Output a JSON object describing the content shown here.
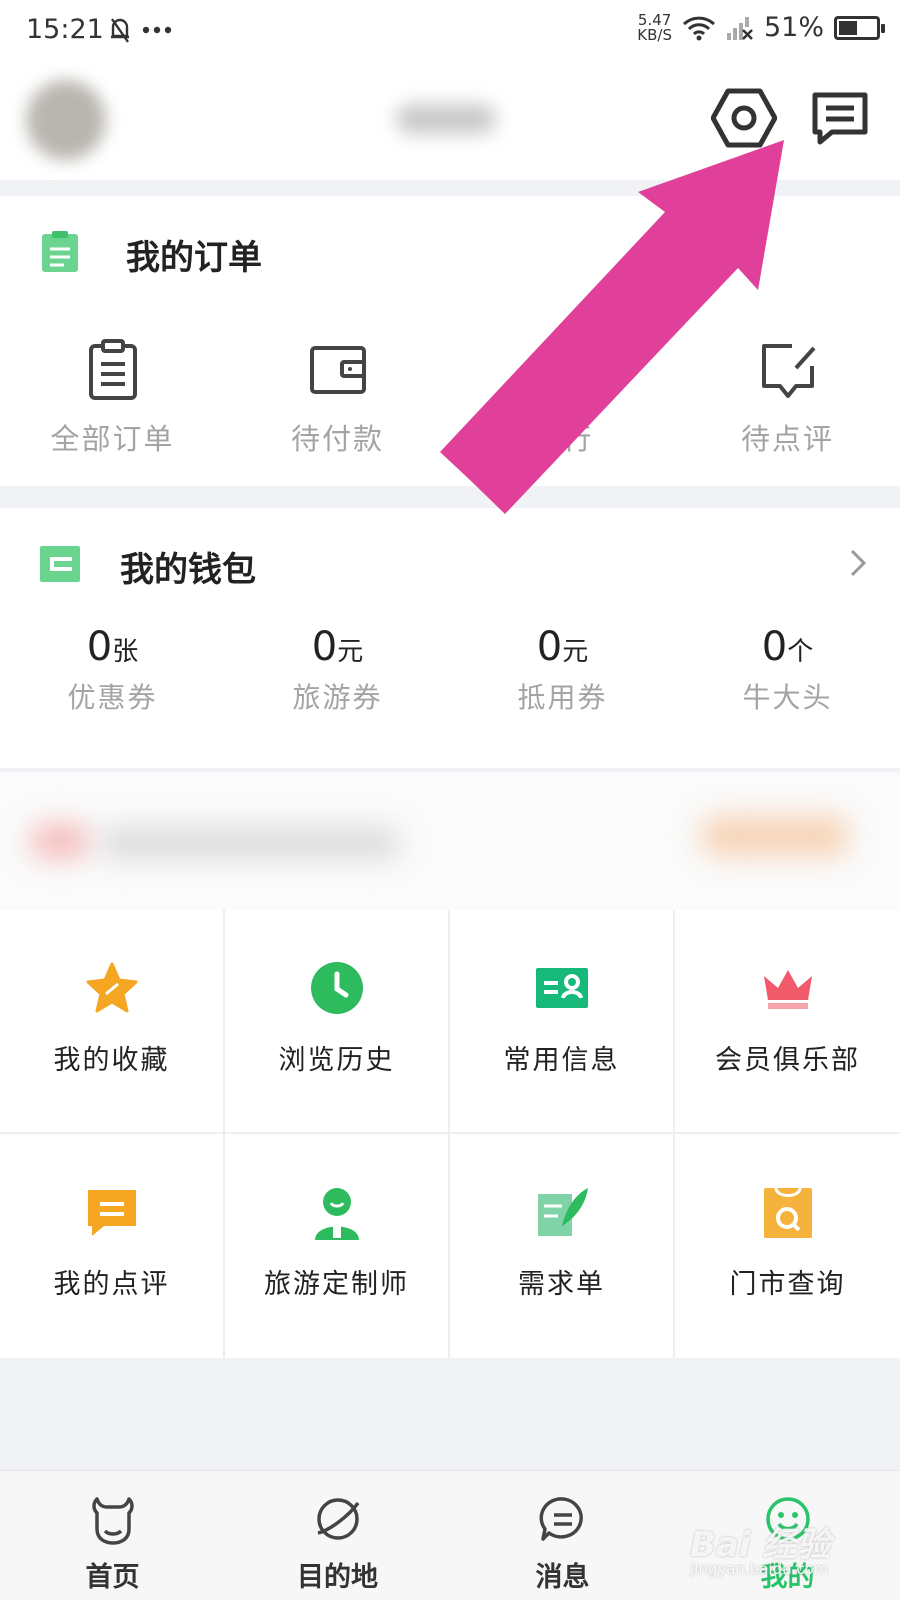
{
  "status_bar": {
    "time": "15:21",
    "network_speed_value": "5.47",
    "network_speed_unit": "KB/S",
    "battery_percent": "51%",
    "battery_level": 0.51
  },
  "header": {
    "settings_icon": "hexagon-settings-icon",
    "message_icon": "message-icon"
  },
  "orders": {
    "title": "我的订单",
    "items": [
      {
        "label": "全部订单",
        "icon": "clipboard-icon"
      },
      {
        "label": "待付款",
        "icon": "wallet-icon"
      },
      {
        "label": "出行",
        "icon": "footprint-icon"
      },
      {
        "label": "待点评",
        "icon": "review-icon"
      }
    ]
  },
  "wallet": {
    "title": "我的钱包",
    "items": [
      {
        "value": "0",
        "unit": "张",
        "label": "优惠券"
      },
      {
        "value": "0",
        "unit": "元",
        "label": "旅游券"
      },
      {
        "value": "0",
        "unit": "元",
        "label": "抵用券"
      },
      {
        "value": "0",
        "unit": "个",
        "label": "牛大头"
      }
    ]
  },
  "services": [
    {
      "label": "我的收藏",
      "icon": "star-icon",
      "color": "#f5a623"
    },
    {
      "label": "浏览历史",
      "icon": "clock-icon",
      "color": "#2dbb5d"
    },
    {
      "label": "常用信息",
      "icon": "id-card-icon",
      "color": "#17b97a"
    },
    {
      "label": "会员俱乐部",
      "icon": "crown-icon",
      "color": "#f05a6a"
    },
    {
      "label": "我的点评",
      "icon": "comment-icon",
      "color": "#f5a623"
    },
    {
      "label": "旅游定制师",
      "icon": "person-icon",
      "color": "#2dbb5d"
    },
    {
      "label": "需求单",
      "icon": "quill-doc-icon",
      "color": "#7fd3a6"
    },
    {
      "label": "门市查询",
      "icon": "store-search-icon",
      "color": "#f5b23c"
    }
  ],
  "bottom_nav": [
    {
      "label": "首页",
      "icon": "cow-face-icon",
      "active": false
    },
    {
      "label": "目的地",
      "icon": "planet-icon",
      "active": false
    },
    {
      "label": "消息",
      "icon": "chat-bubble-icon",
      "active": false
    },
    {
      "label": "我的",
      "icon": "smile-icon",
      "active": true
    }
  ],
  "colors": {
    "accent": "#29c36a",
    "annotation_arrow": "#e0409a",
    "section_icon": "#6bd48f"
  },
  "watermark": {
    "text": "Bai 经验",
    "sub": "jingyan.baidu.com"
  }
}
